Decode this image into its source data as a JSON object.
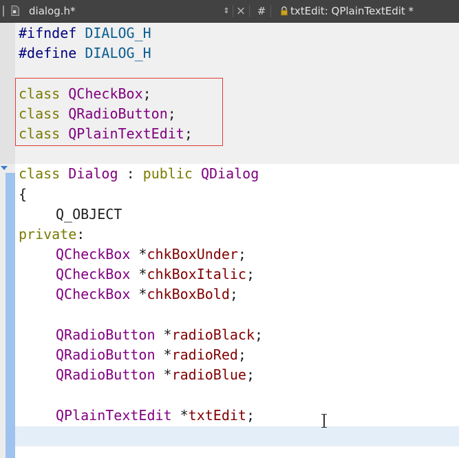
{
  "toolbar": {
    "file_name": "dialog.h*",
    "updown_glyph": "⇕",
    "close_glyph": "×",
    "hash_glyph": "#",
    "symbol": "txtEdit: QPlainTextEdit *"
  },
  "code": {
    "l1": {
      "directive": "#ifndef",
      "macro": "DIALOG_H"
    },
    "l2": {
      "directive": "#define",
      "macro": "DIALOG_H"
    },
    "fwd": [
      {
        "kw": "class",
        "name": "QCheckBox",
        "end": ";"
      },
      {
        "kw": "class",
        "name": "QRadioButton",
        "end": ";"
      },
      {
        "kw": "class",
        "name": "QPlainTextEdit",
        "end": ";"
      }
    ],
    "decl": {
      "kw": "class",
      "name": "Dialog",
      "colon": ":",
      "access": "public",
      "base": "QDialog"
    },
    "brace": "{",
    "qobject": "Q_OBJECT",
    "private_kw": "private",
    "private_colon": ":",
    "members": [
      {
        "type": "QCheckBox",
        "ptr": "*",
        "name": "chkBoxUnder",
        "end": ";"
      },
      {
        "type": "QCheckBox",
        "ptr": "*",
        "name": "chkBoxItalic",
        "end": ";"
      },
      {
        "type": "QCheckBox",
        "ptr": "*",
        "name": "chkBoxBold",
        "end": ";"
      },
      {
        "type": "QRadioButton",
        "ptr": "*",
        "name": "radioBlack",
        "end": ";"
      },
      {
        "type": "QRadioButton",
        "ptr": "*",
        "name": "radioRed",
        "end": ";"
      },
      {
        "type": "QRadioButton",
        "ptr": "*",
        "name": "radioBlue",
        "end": ";"
      },
      {
        "type": "QPlainTextEdit",
        "ptr": "*",
        "name": "txtEdit",
        "end": ";"
      }
    ]
  },
  "colors": {
    "highlight_box": "#e03a3a",
    "toolbar_bg": "#424242",
    "fold_bar": "#9fc3ee"
  }
}
